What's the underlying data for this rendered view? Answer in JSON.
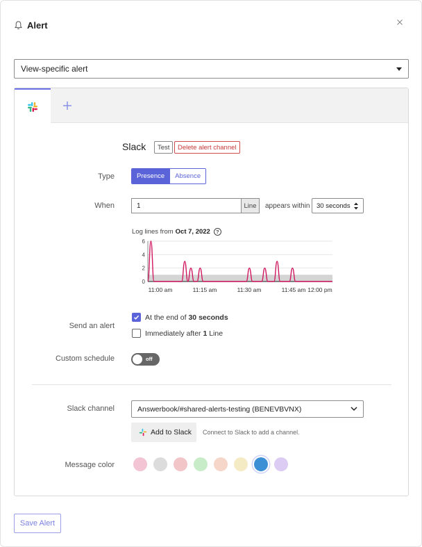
{
  "header": {
    "title": "Alert"
  },
  "view_select": {
    "value": "View-specific alert"
  },
  "channel": {
    "heading": "Slack",
    "test_label": "Test",
    "delete_label": "Delete alert channel"
  },
  "type_row": {
    "label": "Type",
    "options": [
      "Presence",
      "Absence"
    ],
    "selected": "Presence"
  },
  "when_row": {
    "label": "When",
    "count": "1",
    "unit": "Line",
    "appears_within": "appears within",
    "window": "30 seconds"
  },
  "chart_data": {
    "type": "area",
    "title_prefix": "Log lines from",
    "title_date": "Oct 7, 2022",
    "x_ticks": [
      "11:00 am",
      "11:15 am",
      "11:30 am",
      "11:45 am",
      "12:00 pm"
    ],
    "y_ticks": [
      0,
      2,
      4,
      6
    ],
    "ylim": [
      0,
      6
    ],
    "threshold": 1,
    "series": [
      {
        "x": [
          0,
          1,
          2,
          3,
          4,
          5,
          6,
          7,
          8,
          9,
          10,
          11,
          12,
          13,
          14,
          15,
          16,
          17,
          18,
          19,
          20,
          21,
          22,
          23,
          24,
          25,
          26,
          27,
          28,
          29,
          30,
          31,
          32,
          33,
          34,
          35,
          36,
          37,
          38,
          39,
          40,
          41,
          42,
          43,
          44,
          45,
          46,
          47,
          48,
          49,
          50,
          51,
          52,
          53,
          54,
          55,
          56,
          57,
          58,
          59,
          60
        ],
        "values": [
          0,
          6,
          0,
          0,
          0,
          0,
          0,
          0,
          0,
          0,
          0,
          0,
          3,
          0,
          2,
          0,
          0,
          2,
          0,
          0,
          0,
          0,
          0,
          0,
          0,
          0,
          0,
          0,
          0,
          0,
          0,
          0,
          0,
          2,
          0,
          0,
          0,
          0,
          2,
          0,
          0,
          0,
          3,
          0,
          0,
          0,
          0,
          2,
          0,
          0,
          0,
          0,
          0,
          0,
          0,
          0,
          0,
          0,
          0,
          0,
          0
        ]
      }
    ],
    "colors": {
      "line": "#d0175f",
      "threshold_band": "#d4d4d4"
    }
  },
  "send_alert": {
    "label": "Send an alert",
    "option1_prefix": "At the end of",
    "option1_value": "30 seconds",
    "option1_checked": true,
    "option2_prefix": "Immediately after",
    "option2_value": "1",
    "option2_suffix": "Line",
    "option2_checked": false
  },
  "schedule": {
    "label": "Custom schedule",
    "toggle_text": "off"
  },
  "slack_channel": {
    "label": "Slack channel",
    "value": "Answerbook/#shared-alerts-testing (BENEVBVNX)",
    "add_label": "Add to Slack",
    "note": "Connect to Slack to add a channel."
  },
  "message_color": {
    "label": "Message color",
    "swatches": [
      "#f3c4d3",
      "#dcdcdc",
      "#f2c5c9",
      "#c8ecc8",
      "#f5d6c8",
      "#f4ebc5",
      "#3b8fd5",
      "#dcccf4"
    ],
    "selected_index": 6
  },
  "footer": {
    "save_label": "Save Alert"
  },
  "icons": [
    "bell-icon",
    "close-icon",
    "slack-icon",
    "plus-icon",
    "help-icon",
    "check-icon"
  ]
}
